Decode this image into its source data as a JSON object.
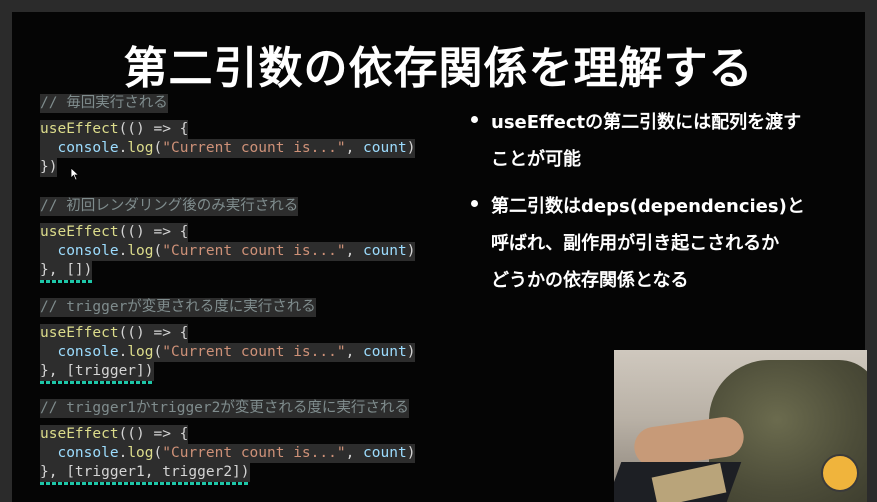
{
  "slide": {
    "title": "第二引数の依存関係を理解する"
  },
  "code_blocks": [
    {
      "comment": "// 毎回実行される",
      "line1_fn": "useEffect",
      "line1_rest": "(() => {",
      "line2_obj": "console",
      "line2_dot": ".",
      "line2_method": "log",
      "line2_open": "(",
      "line2_str": "\"Current count is...\"",
      "line2_sep": ", ",
      "line2_var": "count",
      "line2_close": ")",
      "line3": "})"
    },
    {
      "comment": "// 初回レンダリング後のみ実行される",
      "line1_fn": "useEffect",
      "line1_rest": "(() => {",
      "line2_obj": "console",
      "line2_dot": ".",
      "line2_method": "log",
      "line2_open": "(",
      "line2_str": "\"Current count is...\"",
      "line2_sep": ", ",
      "line2_var": "count",
      "line2_close": ")",
      "line3": "}, [])"
    },
    {
      "comment": "// triggerが変更される度に実行される",
      "line1_fn": "useEffect",
      "line1_rest": "(() => {",
      "line2_obj": "console",
      "line2_dot": ".",
      "line2_method": "log",
      "line2_open": "(",
      "line2_str": "\"Current count is...\"",
      "line2_sep": ", ",
      "line2_var": "count",
      "line2_close": ")",
      "line3": "}, [trigger])"
    },
    {
      "comment": "// trigger1かtrigger2が変更される度に実行される",
      "line1_fn": "useEffect",
      "line1_rest": "(() => {",
      "line2_obj": "console",
      "line2_dot": ".",
      "line2_method": "log",
      "line2_open": "(",
      "line2_str": "\"Current count is...\"",
      "line2_sep": ", ",
      "line2_var": "count",
      "line2_close": ")",
      "line3": "}, [trigger1, trigger2])"
    }
  ],
  "bullets": [
    {
      "line1": "useEffectの第二引数には配列を渡す",
      "line2": "ことが可能"
    },
    {
      "line1": "第二引数はdeps(dependencies)と",
      "line2": "呼ばれ、副作用が引き起こされるか",
      "line3": "どうかの依存関係となる"
    }
  ],
  "colors": {
    "background": "#050505",
    "comment": "#7f8c8d",
    "function": "#dcdc8b",
    "string": "#ce9178",
    "squiggle": "#1ec6a8"
  },
  "icons": [
    "mouse-cursor-icon",
    "avatar-badge-icon"
  ]
}
